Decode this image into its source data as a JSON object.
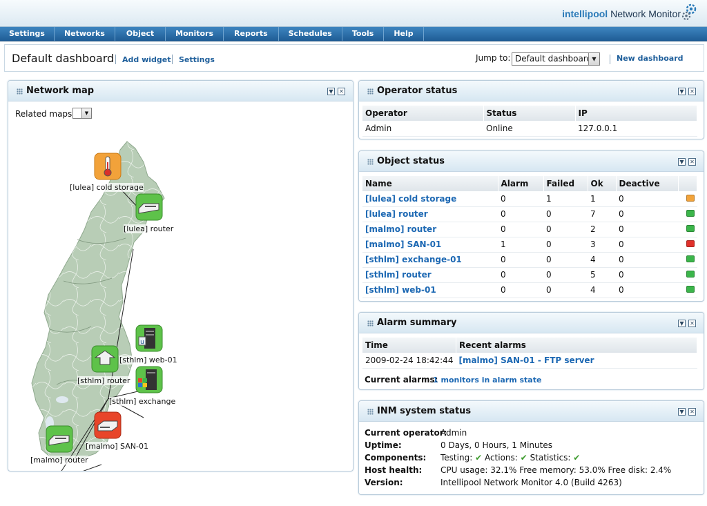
{
  "brand": {
    "part1": "intellipool",
    "part2": " Network Monitor"
  },
  "menu": [
    "Settings",
    "Networks",
    "Object",
    "Monitors",
    "Reports",
    "Schedules",
    "Tools",
    "Help"
  ],
  "dashboard": {
    "title": "Default dashboard",
    "add_widget": "Add widget",
    "settings": "Settings",
    "jump_label": "Jump to:",
    "jump_value": "Default dashboard",
    "new_dashboard": "New dashboard"
  },
  "network_map": {
    "title": "Network map",
    "related_maps_label": "Related maps",
    "nodes": {
      "lulea_cold": "[lulea] cold storage",
      "lulea_router": "[lulea] router",
      "sthlm_web": "[sthlm] web-01",
      "sthlm_router": "[sthlm] router",
      "sthlm_exchange": "[sthlm] exchange",
      "malmo_san": "[malmo] SAN-01",
      "malmo_router": "[malmo] router"
    }
  },
  "operator_status": {
    "title": "Operator status",
    "columns": [
      "Operator",
      "Status",
      "IP"
    ],
    "rows": [
      {
        "operator": "Admin",
        "status": "Online",
        "ip": "127.0.0.1"
      }
    ]
  },
  "object_status": {
    "title": "Object status",
    "columns": [
      "Name",
      "Alarm",
      "Failed",
      "Ok",
      "Deactive"
    ],
    "rows": [
      {
        "name": "[lulea] cold storage",
        "alarm": "0",
        "failed": "1",
        "ok": "1",
        "deactive": "0",
        "color": "#f2a33a"
      },
      {
        "name": "[lulea] router",
        "alarm": "0",
        "failed": "0",
        "ok": "7",
        "deactive": "0",
        "color": "#3bb54a"
      },
      {
        "name": "[malmo] router",
        "alarm": "0",
        "failed": "0",
        "ok": "2",
        "deactive": "0",
        "color": "#3bb54a"
      },
      {
        "name": "[malmo] SAN-01",
        "alarm": "1",
        "failed": "0",
        "ok": "3",
        "deactive": "0",
        "color": "#e0302a"
      },
      {
        "name": "[sthlm] exchange-01",
        "alarm": "0",
        "failed": "0",
        "ok": "4",
        "deactive": "0",
        "color": "#3bb54a"
      },
      {
        "name": "[sthlm] router",
        "alarm": "0",
        "failed": "0",
        "ok": "5",
        "deactive": "0",
        "color": "#3bb54a"
      },
      {
        "name": "[sthlm] web-01",
        "alarm": "0",
        "failed": "0",
        "ok": "4",
        "deactive": "0",
        "color": "#3bb54a"
      }
    ]
  },
  "alarm_summary": {
    "title": "Alarm summary",
    "columns": [
      "Time",
      "Recent alarms"
    ],
    "rows": [
      {
        "time": "2009-02-24 18:42:44",
        "alarm": "[malmo] SAN-01 - FTP server"
      }
    ],
    "current_label": "Current alarms:",
    "current_link": "1 monitors in alarm state"
  },
  "system_status": {
    "title": "INM system status",
    "current_operator": {
      "label": "Current operator:",
      "value": "Admin"
    },
    "uptime": {
      "label": "Uptime:",
      "value": "0 Days, 0 Hours, 1 Minutes"
    },
    "components": {
      "label": "Components:",
      "testing": "Testing:",
      "actions": "Actions:",
      "statistics": "Statistics:"
    },
    "host_health": {
      "label": "Host health:",
      "value": "CPU usage: 32.1% Free memory: 53.0% Free disk: 2.4%"
    },
    "version": {
      "label": "Version:",
      "value": "Intellipool Network Monitor 4.0 (Build 4263)"
    }
  }
}
